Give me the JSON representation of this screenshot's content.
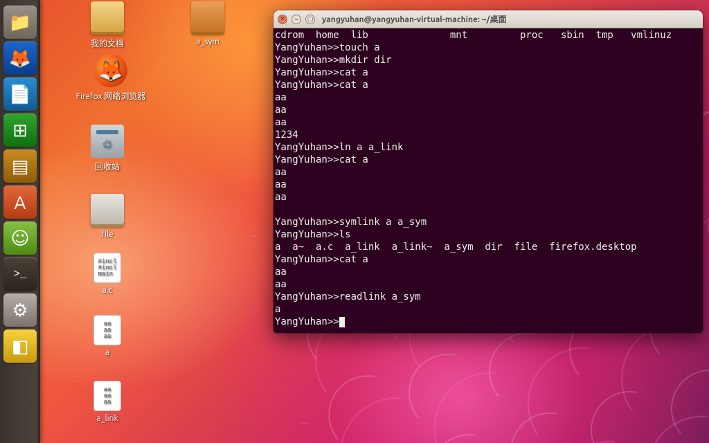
{
  "launcher": {
    "items": [
      {
        "name": "files",
        "glyph": "📁"
      },
      {
        "name": "firefox",
        "glyph": "🦊"
      },
      {
        "name": "writer",
        "glyph": "📄"
      },
      {
        "name": "calc",
        "glyph": "⊞"
      },
      {
        "name": "impress",
        "glyph": "▤"
      },
      {
        "name": "software",
        "glyph": "A"
      },
      {
        "name": "chat",
        "glyph": "☺"
      },
      {
        "name": "terminal",
        "glyph": ">_"
      },
      {
        "name": "settings",
        "glyph": "⚙"
      },
      {
        "name": "screenshot",
        "glyph": "◧"
      }
    ]
  },
  "desktop": {
    "icons": {
      "mydocs": "我的文档",
      "a_sym": "a_sym",
      "firefox": "Firefox 网络浏览器",
      "trash": "回收站",
      "file": "file",
      "ac": "a.c",
      "a": "a",
      "a_link": "a_link"
    },
    "txt_sample": "#incl\n#incl\nmain"
  },
  "terminal": {
    "title": "yangyuhan@yangyuhan-virtual-machine: ~/桌面",
    "prompt": "YangYuhan>>",
    "lines": [
      "cdrom  home  lib              mnt         proc   sbin  tmp   vmlinuz",
      "YangYuhan>>touch a",
      "YangYuhan>>mkdir dir",
      "YangYuhan>>cat a",
      "YangYuhan>>cat a",
      "aa",
      "aa",
      "aa",
      "1234",
      "YangYuhan>>ln a a_link",
      "YangYuhan>>cat a",
      "aa",
      "aa",
      "aa",
      "",
      "YangYuhan>>symlink a a_sym",
      "YangYuhan>>ls",
      "a  a~  a.c  a_link  a_link~  a_sym  dir  file  firefox.desktop",
      "YangYuhan>>cat a",
      "aa",
      "aa",
      "YangYuhan>>readlink a_sym",
      "a",
      "YangYuhan>>"
    ]
  }
}
